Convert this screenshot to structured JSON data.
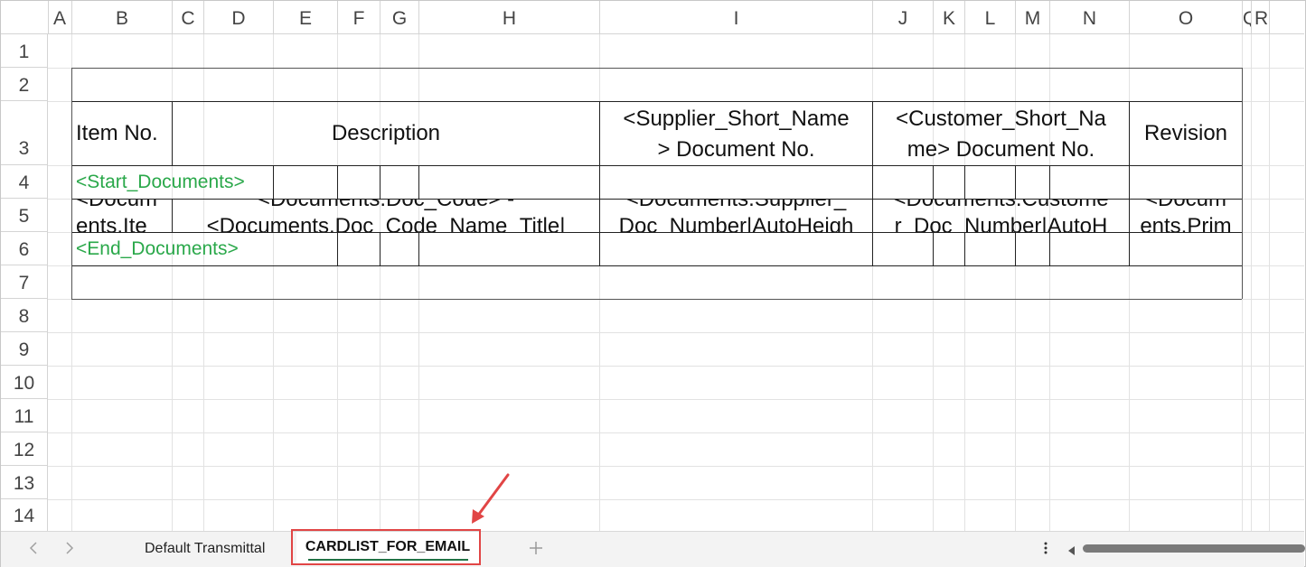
{
  "columns": [
    "A",
    "B",
    "C",
    "D",
    "E",
    "F",
    "G",
    "H",
    "I",
    "J",
    "K",
    "L",
    "M",
    "N",
    "O",
    "Q",
    "R"
  ],
  "rows": [
    "1",
    "2",
    "3",
    "4",
    "5",
    "6",
    "7",
    "8",
    "9",
    "10",
    "11",
    "12",
    "13",
    "14"
  ],
  "cells": {
    "item_no": "Item No.",
    "description": "Description",
    "supplier_doc_line1": "<Supplier_Short_Name",
    "supplier_doc_line2": "> Document No.",
    "customer_doc_line1": "<Customer_Short_Na",
    "customer_doc_line2": "me> Document No.",
    "revision": "Revision",
    "start_documents": "<Start_Documents>",
    "end_documents": "<End_Documents>",
    "r5_b_line1": "<Docum",
    "r5_b_line2": "ents.Ite",
    "r5_desc_line1": "<Documents.Doc_Code> -",
    "r5_desc_line2": "<Documents.Doc_Code_Name_Title|",
    "r5_supplier_line1": "<Documents.Supplier_",
    "r5_supplier_line2": "Doc_Number|AutoHeigh",
    "r5_customer_line1": "<Documents.Custome",
    "r5_customer_line2": "r_Doc_Number|AutoH",
    "r5_rev_line1": "<Docum",
    "r5_rev_line2": "ents.Prim"
  },
  "sheet_tabs": {
    "tab1": "Default Transmittal",
    "tab2": "CARDLIST_FOR_EMAIL",
    "add_icon": "plus-icon",
    "prev_icon": "chevron-left-icon",
    "next_icon": "chevron-right-icon",
    "more_icon": "more-vertical-icon"
  },
  "colors": {
    "green_text": "#2aa84a",
    "highlight": "#e14545",
    "active_tab_underline": "#217346"
  }
}
